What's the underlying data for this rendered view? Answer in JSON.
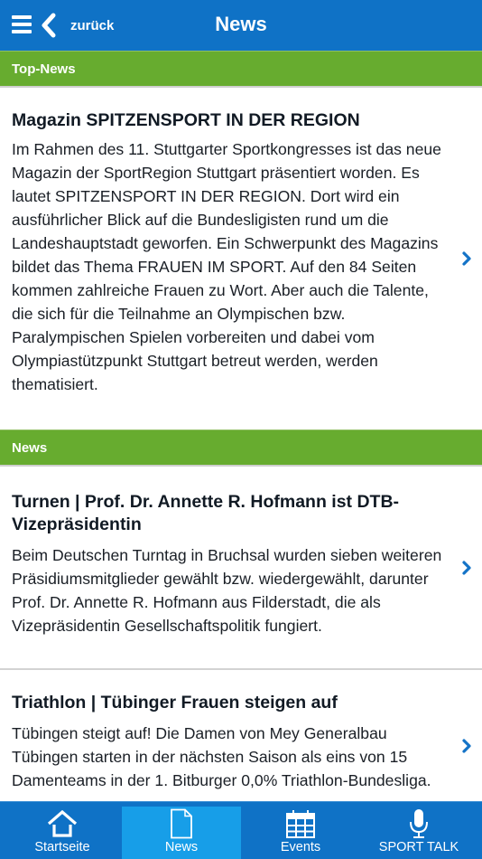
{
  "header": {
    "menu_icon": "hamburger-menu-icon",
    "back_icon": "chevron-left-icon",
    "back_label": "zurück",
    "title": "News"
  },
  "sections": [
    {
      "label": "Top-News"
    },
    {
      "label": "News"
    }
  ],
  "top_news": {
    "title": "Magazin SPITZENSPORT IN DER REGION",
    "body": "Im Rahmen des 11. Stuttgarter Sportkongresses ist das neue Magazin der SportRegion Stuttgart präsentiert worden. Es lautet SPITZENSPORT IN DER REGION. Dort wird ein ausführlicher Blick auf die Bundesligisten rund um die Landeshauptstadt geworfen. Ein Schwerpunkt des Magazins bildet das Thema FRAUEN IM SPORT. Auf den 84 Seiten kommen zahlreiche Frauen zu Wort. Aber auch die Talente, die sich für die Teilnahme an Olympischen bzw. Paralympischen Spielen vorbereiten und dabei vom Olympiastützpunkt Stuttgart betreut werden, werden thematisiert."
  },
  "news": [
    {
      "title": "Turnen | Prof. Dr. Annette R. Hofmann ist DTB-Vizepräsidentin",
      "body": "Beim Deutschen Turntag in Bruchsal wurden sieben weiteren Präsidiumsmitglieder gewählt bzw. wiedergewählt, darunter Prof. Dr. Annette R. Hofmann aus Filderstadt, die als Vizepräsidentin Gesellschaftspolitik fungiert."
    },
    {
      "title": "Triathlon | Tübinger Frauen steigen auf",
      "body": "Tübingen steigt auf! Die Damen von Mey Generalbau Tübingen starten in der nächsten Saison als eins von 15 Damenteams in der 1. Bitburger 0,0% Triathlon-Bundesliga."
    }
  ],
  "tabbar": {
    "active": "News",
    "tabs": [
      {
        "label": "Startseite",
        "icon": "home-icon"
      },
      {
        "label": "News",
        "icon": "document-icon"
      },
      {
        "label": "Events",
        "icon": "calendar-icon"
      },
      {
        "label": "SPORT TALK",
        "icon": "microphone-icon"
      }
    ]
  },
  "colors": {
    "header_blue": "#0f72c6",
    "section_green": "#67ac2f",
    "active_tab": "#179ee8",
    "chevron_blue": "#1473c7"
  }
}
